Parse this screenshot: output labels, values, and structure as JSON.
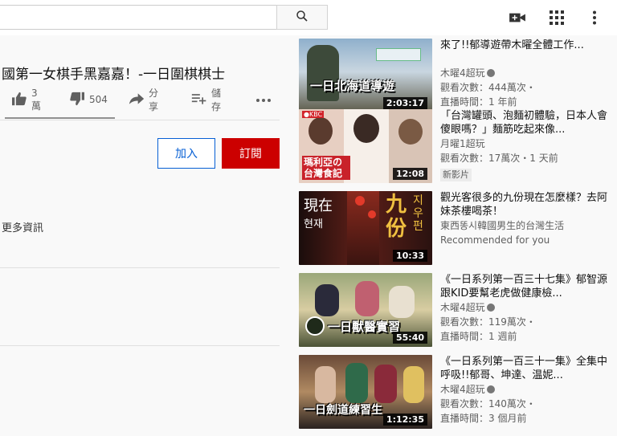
{
  "header": {
    "search_placeholder": "",
    "icons": [
      "search-icon",
      "video-camera-icon",
      "apps-grid-icon",
      "more-vert-icon"
    ]
  },
  "video": {
    "title": "國第一女棋手黑嘉嘉！-一日圍棋棋士",
    "likes": "3萬",
    "dislikes": "504",
    "share_label": "分享",
    "save_label": "儲存",
    "join_label": "加入",
    "subscribe_label": "訂閱",
    "more_info": "更多資訊"
  },
  "recommendations": [
    {
      "title": "來了!!郁導遊帶木曜全體工作...",
      "channel": "木曜4超玩",
      "verified": true,
      "views": "觀看次數：444萬次・",
      "time": "直播時間：1 年前",
      "duration": "2:03:17",
      "thumb_text": "一日北海道導遊",
      "thumb_colors": [
        "#6d8aa8",
        "#b9c8d6",
        "#3b3f36"
      ]
    },
    {
      "title": "「台灣罐頭、泡麵初體驗，日本人會傻眼嗎？」麵筋吃起來像...",
      "channel": "月曜1超玩",
      "verified": false,
      "views": "觀看次數：17萬次・1 天前",
      "time": "",
      "badge": "新影片",
      "duration": "12:08",
      "thumb_text": "瑪利亞の台灣食記",
      "thumb_colors": [
        "#e9c4b0",
        "#f4e6dd",
        "#c9222a"
      ]
    },
    {
      "title": "觀光客很多的九份現在怎麼樣？去阿妹茶樓喝茶！",
      "channel": "東西똥시韓國男生的台灣生活",
      "verified": false,
      "views": "Recommended for you",
      "time": "",
      "duration": "10:33",
      "thumb_text_a": "現在",
      "thumb_text_b": "현재",
      "thumb_text_c": "九份",
      "thumb_text_d": "지우펀",
      "thumb_colors": [
        "#2a1412",
        "#7a2a1e",
        "#e0b23a"
      ]
    },
    {
      "title": "《一日系列第一百三十七集》郁智源跟KID要幫老虎做健康檢...",
      "channel": "木曜4超玩",
      "verified": true,
      "views": "觀看次數：119萬次・",
      "time": "直播時間：1 週前",
      "duration": "55:40",
      "thumb_text": "一日獸醫實習",
      "thumb_colors": [
        "#7d8a5a",
        "#c7b98a",
        "#2f3a2a"
      ]
    },
    {
      "title": "《一日系列第一百三十一集》全集中呼吸!!郁哥、坤達、温妮...",
      "channel": "木曜4超玩",
      "verified": true,
      "views": "觀看次數：140萬次・",
      "time": "直播時間：3 個月前",
      "duration": "1:12:35",
      "thumb_text": "一日劍道練習生",
      "thumb_colors": [
        "#5a3a2c",
        "#a8805a",
        "#1f1a18"
      ]
    }
  ]
}
